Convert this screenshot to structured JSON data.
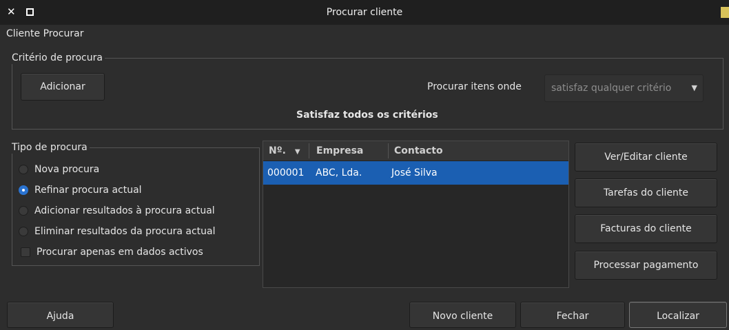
{
  "window": {
    "title": "Procurar cliente",
    "heading": "Cliente Procurar"
  },
  "criteria": {
    "legend": "Critério de procura",
    "add_label": "Adicionar",
    "match_label": "Procurar itens onde",
    "match_value": "satisfaz qualquer critério",
    "summary": "Satisfaz todos os critérios"
  },
  "search_type": {
    "legend": "Tipo de procura",
    "options": [
      {
        "label": "Nova procura",
        "selected": false
      },
      {
        "label": "Refinar procura actual",
        "selected": true
      },
      {
        "label": "Adicionar resultados à procura actual",
        "selected": false
      },
      {
        "label": "Eliminar resultados da procura actual",
        "selected": false
      }
    ],
    "active_only_label": "Procurar apenas em dados activos",
    "active_only_checked": false
  },
  "results": {
    "columns": [
      "Nº.",
      "Empresa",
      "Contacto"
    ],
    "rows": [
      {
        "number": "000001",
        "company": "ABC, Lda.",
        "contact": "José Silva"
      }
    ]
  },
  "actions": {
    "view_edit": "Ver/Editar cliente",
    "tasks": "Tarefas do cliente",
    "invoices": "Facturas do cliente",
    "payment": "Processar pagamento"
  },
  "footer": {
    "help": "Ajuda",
    "new_customer": "Novo cliente",
    "close": "Fechar",
    "find": "Localizar"
  },
  "colors": {
    "selection": "#1b5fb2",
    "radio_selected": "#2a73d0",
    "background": "#2d2d2d"
  }
}
